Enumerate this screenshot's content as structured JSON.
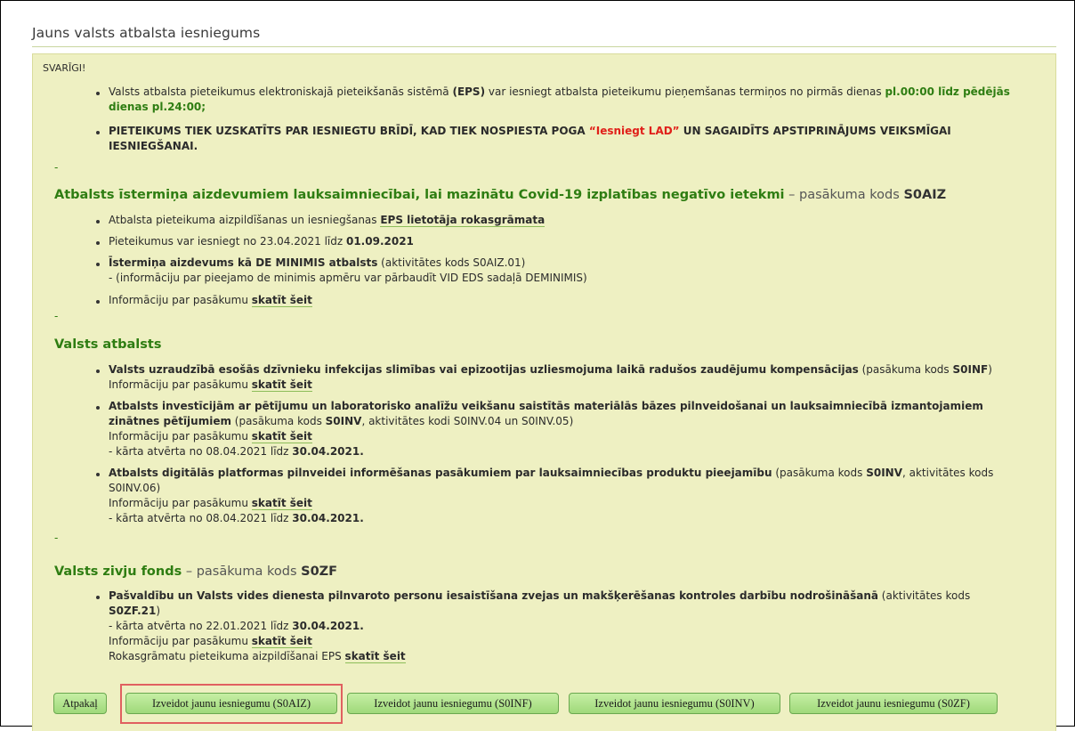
{
  "page_title": "Jauns valsts atbalsta iesniegums",
  "important": {
    "label": "SVARĪGI!",
    "b1_a": "Valsts atbalsta pieteikumus elektroniskajā pieteikšanās sistēmā ",
    "b1_b": "(EPS)",
    "b1_c": " var iesniegt atbalsta pieteikumu pieņemšanas termiņos no pirmās dienas ",
    "b1_d": "pl.00:00 līdz pēdējās",
    "b1_e": "dienas pl.24:00;",
    "b2_a": "PIETEIKUMS TIEK UZSKATĪTS PAR IESNIEGTU BRĪDĪ, KAD TIEK NOSPIESTA POGA ",
    "b2_b": "“Iesniegt LAD”",
    "b2_c": " UN SAGAIDĪTS APSTIPRINĀJUMS VEIKSMĪGAI",
    "b2_d": "IESNIEGŠANAI."
  },
  "dash": "-",
  "s1": {
    "title": "Atbalsts īstermiņa aizdevumiem lauksaimniecībai, lai mazinātu Covid-19 izplatības negatīvo ietekmi",
    "code_prefix": " – pasākuma kods ",
    "code": "S0AIZ",
    "i1_text": "Atbalsta pieteikuma aizpildīšanas un iesniegšanas ",
    "i1_link": "EPS lietotāja rokasgrāmata",
    "i2_text": "Pieteikumus var iesniegt no 23.04.2021 līdz ",
    "i2_date": "01.09.2021",
    "i3_bold": "Īstermiņa aizdevums kā DE MINIMIS atbalsts",
    "i3_text": " (aktivitātes kods S0AIZ.01)",
    "i3_line2": "- (informāciju par pieejamo de minimis apmēru var pārbaudīt VID EDS sadaļā DEMINIMIS)",
    "i4_text": "Informāciju par pasākumu ",
    "i4_link": "skatīt šeit"
  },
  "s2": {
    "title": "Valsts atbalsts",
    "a_bold": "Valsts uzraudzībā esošās dzīvnieku infekcijas slimības vai epizootijas uzliesmojuma laikā radušos zaudējumu kompensācijas",
    "a_text": " (pasākuma kods ",
    "a_code": "S0INF",
    "a_close": ")",
    "info_text": "Informāciju par pasākumu ",
    "info_link": "skatīt šeit",
    "b_bold1": "Atbalsts investīcijām ar pētījumu un laboratorisko analīžu veikšanu saistītās materiālās bāzes pilnveidošanai un lauksaimniecībā izmantojamiem",
    "b_bold2": "zinātnes pētījumiem",
    "b_text": " (pasākuma kods ",
    "b_code": "S0INV",
    "b_text2": ", aktivitātes kodi S0INV.04 un S0INV.05)",
    "round_text": "- kārta atvērta no 08.04.2021 līdz ",
    "round_date": "30.04.2021.",
    "c_bold": "Atbalsts digitālās platformas pilnveidei informēšanas pasākumiem par lauksaimniecības produktu pieejamību",
    "c_text": " (pasākuma kods ",
    "c_code": "S0INV",
    "c_text2": ", aktivitātes kods",
    "c_line2": "S0INV.06)"
  },
  "s3": {
    "title": "Valsts zivju fonds",
    "code_prefix": " – pasākuma kods ",
    "code": "S0ZF",
    "bold": "Pašvaldību un Valsts vides dienesta pilnvaroto personu iesaistīšana zvejas un makšķerēšanas kontroles darbību nodrošināšanā",
    "text": " (aktivitātes kods",
    "code2": "S0ZF.21",
    "close": ")",
    "round_text": "- kārta atvērta no 22.01.2021 līdz ",
    "round_date": "30.04.2021.",
    "info_text": "Informāciju par pasākumu ",
    "info_link": "skatīt šeit",
    "guide_text": "Rokasgrāmatu pieteikuma aizpildīšanai EPS ",
    "guide_link": "skatīt šeit"
  },
  "buttons": {
    "back": "Atpakaļ",
    "aiz": "Izveidot jaunu iesniegumu (S0AIZ)",
    "inf": "Izveidot jaunu iesniegumu (S0INF)",
    "inv": "Izveidot jaunu iesniegumu (S0INV)",
    "zf": "Izveidot jaunu iesniegumu (S0ZF)"
  },
  "colors": {
    "panel_bg": "#eef0c2",
    "accent_green": "#2e7d12",
    "button_green": "#9fd97a",
    "highlight_red": "#e06060",
    "alert_red": "#e0201a"
  }
}
